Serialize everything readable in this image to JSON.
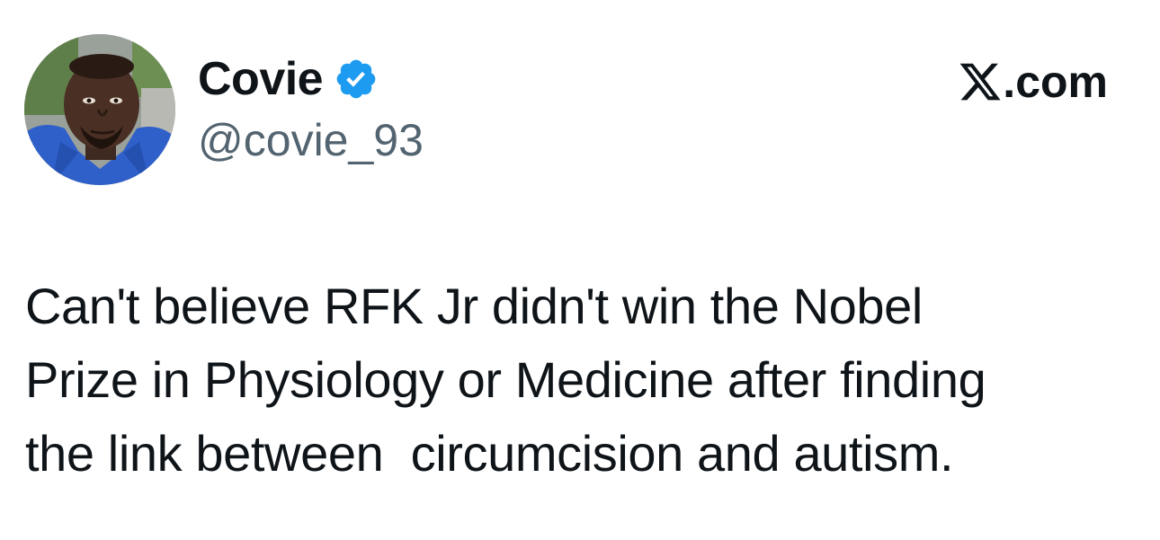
{
  "author": {
    "display_name": "Covie",
    "handle": "@covie_93",
    "verified": true,
    "verified_color": "#1d9bf0",
    "avatar_icon": "profile-photo"
  },
  "site": {
    "logo_icon": "x-logo-icon",
    "label": ".com"
  },
  "tweet": {
    "lines": [
      "Can't believe RFK Jr didn't win the Nobel",
      "Prize in Physiology or Medicine after finding",
      "the link between  circumcision and autism."
    ]
  },
  "colors": {
    "text": "#0f1419",
    "secondary": "#536471",
    "background": "#ffffff"
  }
}
